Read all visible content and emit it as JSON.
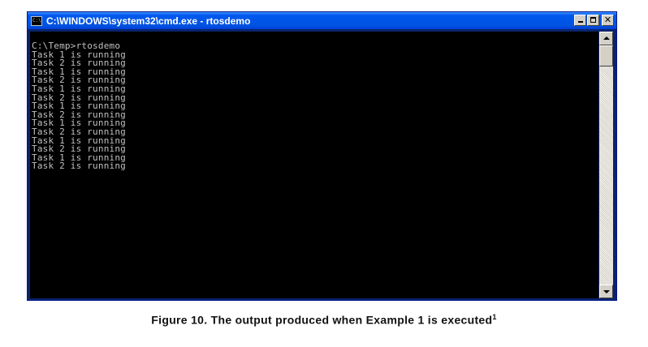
{
  "window": {
    "title": "C:\\WINDOWS\\system32\\cmd.exe - rtosdemo",
    "app_icon": "cmd-console-icon",
    "buttons": [
      "minimize-icon",
      "maximize-icon",
      "close-icon"
    ]
  },
  "console": {
    "lines": [
      "C:\\Temp>rtosdemo",
      "Task 1 is running",
      "Task 2 is running",
      "Task 1 is running",
      "Task 2 is running",
      "Task 1 is running",
      "Task 2 is running",
      "Task 1 is running",
      "Task 2 is running",
      "Task 1 is running",
      "Task 2 is running",
      "Task 1 is running",
      "Task 2 is running",
      "Task 1 is running",
      "Task 2 is running"
    ]
  },
  "caption": {
    "text": "Figure 10.  The output produced when Example 1 is executed",
    "footnote": "1"
  }
}
